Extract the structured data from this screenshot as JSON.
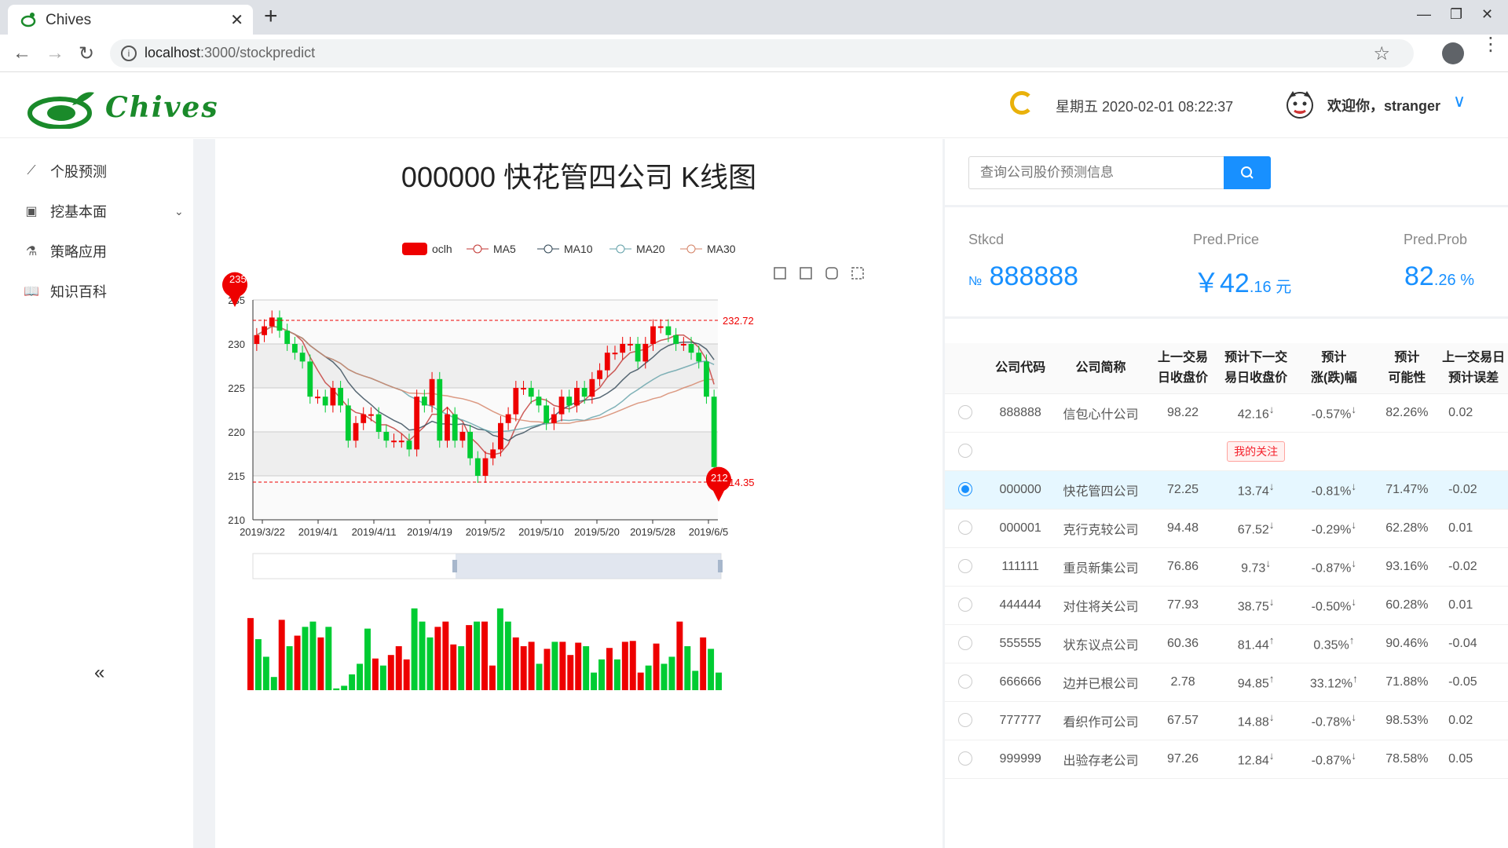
{
  "browser": {
    "tab_title": "Chives",
    "url_host": "localhost",
    "url_rest": ":3000/stockpredict"
  },
  "header": {
    "logo_text": "Chives",
    "datetime": "星期五 2020-02-01 08:22:37",
    "welcome": "欢迎你，stranger"
  },
  "sidebar": {
    "items": [
      {
        "label": "个股预测",
        "icon": "line-chart-icon"
      },
      {
        "label": "挖基本面",
        "icon": "calendar-icon"
      },
      {
        "label": "策略应用",
        "icon": "experiment-icon"
      },
      {
        "label": "知识百科",
        "icon": "book-icon"
      }
    ],
    "collapse": "«"
  },
  "chart": {
    "title": "000000 快花管四公司 K线图",
    "legend": [
      "oclh",
      "MA5",
      "MA10",
      "MA20",
      "MA30"
    ],
    "max_pin": "235",
    "min_pin": "212",
    "markline_high": "232.72",
    "markline_low": "14.35"
  },
  "chart_data": {
    "type": "candlestick",
    "title": "000000 快花管四公司 K线图",
    "x_ticks": [
      "2019/3/22",
      "2019/4/1",
      "2019/4/11",
      "2019/4/19",
      "2019/5/2",
      "2019/5/10",
      "2019/5/20",
      "2019/5/28",
      "2019/6/5"
    ],
    "ylim": [
      210,
      235
    ],
    "y_ticks": [
      210,
      215,
      220,
      225,
      230,
      235
    ],
    "legend": [
      "oclh",
      "MA5",
      "MA10",
      "MA20",
      "MA30"
    ],
    "markline_high": 232.72,
    "markpoint_max": 235,
    "markpoint_min": 212,
    "close": [
      231,
      232,
      233,
      231.5,
      230,
      229,
      228,
      224,
      224,
      223,
      225,
      223,
      219,
      221,
      222,
      222,
      220,
      219,
      219,
      219,
      218,
      224,
      223,
      226,
      219,
      222,
      219,
      220,
      217,
      215,
      217,
      218,
      221,
      222,
      225,
      225,
      224,
      223,
      221,
      222,
      224,
      223,
      225,
      224,
      226,
      227,
      229,
      229,
      230,
      230,
      228,
      230,
      232,
      232,
      231,
      230,
      230,
      229,
      228,
      224,
      216
    ],
    "volume_colors": [
      "#e00",
      "#0c3",
      "#0c3",
      "#0c3",
      "#e00",
      "#0c3",
      "#e00",
      "#0c3",
      "#0c3",
      "#e00",
      "#0c3",
      "#0c3",
      "#0c3",
      "#0c3",
      "#0c3",
      "#0c3",
      "#e00",
      "#0c3",
      "#e00",
      "#e00",
      "#e00",
      "#0c3",
      "#0c3",
      "#0c3",
      "#e00",
      "#e00",
      "#e00",
      "#0c3",
      "#e00",
      "#0c3",
      "#e00",
      "#e00",
      "#0c3",
      "#0c3",
      "#e00",
      "#e00",
      "#e00",
      "#0c3",
      "#e00",
      "#0c3",
      "#e00",
      "#e00",
      "#e00",
      "#0c3",
      "#0c3",
      "#0c3",
      "#e00",
      "#0c3",
      "#e00",
      "#e00",
      "#e00",
      "#0c3",
      "#e00",
      "#0c3",
      "#0c3",
      "#e00",
      "#0c3",
      "#0c3",
      "#e00",
      "#0c3",
      "#0c3"
    ],
    "volume": [
      0.82,
      0.58,
      0.38,
      0.15,
      0.8,
      0.5,
      0.62,
      0.72,
      0.78,
      0.6,
      0.72,
      0.02,
      0.05,
      0.18,
      0.3,
      0.7,
      0.36,
      0.28,
      0.4,
      0.5,
      0.35,
      0.93,
      0.78,
      0.6,
      0.72,
      0.78,
      0.52,
      0.5,
      0.74,
      0.78,
      0.78,
      0.28,
      0.93,
      0.78,
      0.6,
      0.5,
      0.55,
      0.3,
      0.47,
      0.55,
      0.55,
      0.4,
      0.54,
      0.5,
      0.2,
      0.35,
      0.48,
      0.35,
      0.55,
      0.56,
      0.2,
      0.28,
      0.53,
      0.3,
      0.38,
      0.78,
      0.5,
      0.22,
      0.6,
      0.47,
      0.2
    ]
  },
  "search": {
    "placeholder": "查询公司股价预测信息"
  },
  "stats": {
    "stkcd_label": "Stkcd",
    "stkcd_prefix": "№",
    "stkcd_value": "888888",
    "price_label": "Pred.Price",
    "price_int": "￥42",
    "price_dec": ".16 元",
    "prob_label": "Pred.Prob",
    "prob_int": "82",
    "prob_dec": ".26 %"
  },
  "table": {
    "headers": [
      [
        "公司代码"
      ],
      [
        "公司简称"
      ],
      [
        "上一交易",
        "日收盘价"
      ],
      [
        "预计下一交",
        "易日收盘价"
      ],
      [
        "预计",
        "涨(跌)幅"
      ],
      [
        "预计",
        "可能性"
      ],
      [
        "上一交易日",
        "预计误差"
      ]
    ],
    "watch_tag": "我的关注",
    "rows": [
      {
        "code": "888888",
        "name": "信包心什公司",
        "last": "98.22",
        "pred": "42.16",
        "pred_arrow": "↓",
        "chg": "-0.57%",
        "chg_arrow": "↓",
        "prob": "82.26%",
        "err": "0.02",
        "dir": "down",
        "selected": false
      },
      {
        "code": "000000",
        "name": "快花管四公司",
        "last": "72.25",
        "pred": "13.74",
        "pred_arrow": "↓",
        "chg": "-0.81%",
        "chg_arrow": "↓",
        "prob": "71.47%",
        "err": "-0.02",
        "dir": "down",
        "selected": true
      },
      {
        "code": "000001",
        "name": "克行克较公司",
        "last": "94.48",
        "pred": "67.52",
        "pred_arrow": "↓",
        "chg": "-0.29%",
        "chg_arrow": "↓",
        "prob": "62.28%",
        "err": "0.01",
        "dir": "down",
        "selected": false
      },
      {
        "code": "111111",
        "name": "重员新集公司",
        "last": "76.86",
        "pred": "9.73",
        "pred_arrow": "↓",
        "chg": "-0.87%",
        "chg_arrow": "↓",
        "prob": "93.16%",
        "err": "-0.02",
        "dir": "down",
        "selected": false
      },
      {
        "code": "444444",
        "name": "对住将关公司",
        "last": "77.93",
        "pred": "38.75",
        "pred_arrow": "↓",
        "chg": "-0.50%",
        "chg_arrow": "↓",
        "prob": "60.28%",
        "err": "0.01",
        "dir": "down",
        "selected": false
      },
      {
        "code": "555555",
        "name": "状东议点公司",
        "last": "60.36",
        "pred": "81.44",
        "pred_arrow": "↑",
        "chg": "0.35%",
        "chg_arrow": "↑",
        "prob": "90.46%",
        "err": "-0.04",
        "dir": "up",
        "selected": false
      },
      {
        "code": "666666",
        "name": "边并已根公司",
        "last": "2.78",
        "pred": "94.85",
        "pred_arrow": "↑",
        "chg": "33.12%",
        "chg_arrow": "↑",
        "prob": "71.88%",
        "err": "-0.05",
        "dir": "up",
        "selected": false
      },
      {
        "code": "777777",
        "name": "看织作可公司",
        "last": "67.57",
        "pred": "14.88",
        "pred_arrow": "↓",
        "chg": "-0.78%",
        "chg_arrow": "↓",
        "prob": "98.53%",
        "err": "0.02",
        "dir": "down",
        "selected": false
      },
      {
        "code": "999999",
        "name": "出验存老公司",
        "last": "97.26",
        "pred": "12.84",
        "pred_arrow": "↓",
        "chg": "-0.87%",
        "chg_arrow": "↓",
        "prob": "78.58%",
        "err": "0.05",
        "dir": "down",
        "selected": false
      }
    ]
  }
}
